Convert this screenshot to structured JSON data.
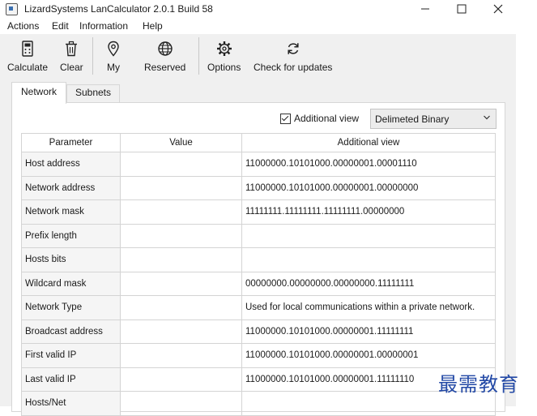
{
  "window": {
    "title": "LizardSystems LanCalculator 2.0.1 Build 58"
  },
  "menu": [
    "Actions",
    "Edit",
    "Information",
    "Help"
  ],
  "toolbar": {
    "calculate": "Calculate",
    "clear": "Clear",
    "my": "My",
    "reserved": "Reserved",
    "options": "Options",
    "check_updates": "Check for updates"
  },
  "tabs": [
    "Network",
    "Subnets"
  ],
  "additional_view": {
    "label": "Additional view",
    "checked": true,
    "selected": "Delimeted Binary"
  },
  "table": {
    "headers": [
      "Parameter",
      "Value",
      "Additional view"
    ],
    "rows": [
      {
        "param": "Host address",
        "value": "",
        "extra": "11000000.10101000.00000001.00001110"
      },
      {
        "param": "Network address",
        "value": "",
        "extra": "11000000.10101000.00000001.00000000"
      },
      {
        "param": "Network mask",
        "value": "",
        "extra": "11111111.11111111.11111111.00000000"
      },
      {
        "param": "Prefix length",
        "value": "",
        "extra": ""
      },
      {
        "param": "Hosts bits",
        "value": "",
        "extra": ""
      },
      {
        "param": "Wildcard mask",
        "value": "",
        "extra": "00000000.00000000.00000000.11111111"
      },
      {
        "param": "Network Type",
        "value": "",
        "extra": "Used for local communications within a private network."
      },
      {
        "param": "Broadcast address",
        "value": "",
        "extra": "11000000.10101000.00000001.11111111"
      },
      {
        "param": "First valid IP",
        "value": "",
        "extra": "11000000.10101000.00000001.00000001"
      },
      {
        "param": "Last valid IP",
        "value": "",
        "extra": "11000000.10101000.00000001.11111110"
      },
      {
        "param": "Hosts/Net",
        "value": "",
        "extra": ""
      }
    ]
  },
  "watermark": "最需教育"
}
